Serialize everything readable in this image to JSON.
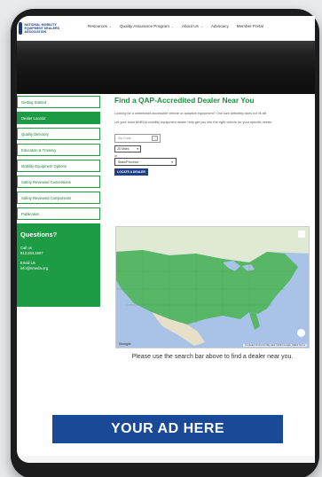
{
  "header": {
    "logo_text": "NATIONAL MOBILITY EQUIPMENT DEALERS ASSOCIATION",
    "menu": [
      {
        "label": "Resources",
        "has_dropdown": true
      },
      {
        "label": "Quality Assurance Program",
        "has_dropdown": true
      },
      {
        "label": "About Us",
        "has_dropdown": true
      },
      {
        "label": "Advocacy",
        "has_dropdown": false
      },
      {
        "label": "Member Portal",
        "has_dropdown": false
      }
    ]
  },
  "sidebar": {
    "items": [
      {
        "label": "Getting Started",
        "active": false
      },
      {
        "label": "Dealer Locator",
        "active": true
      },
      {
        "label": "Quality Directory",
        "active": false
      },
      {
        "label": "Education & Training",
        "active": false
      },
      {
        "label": "Mobility Equipment Options",
        "active": false
      },
      {
        "label": "Safety Reviewed Conversions",
        "active": false
      },
      {
        "label": "Safety Reviewed Components",
        "active": false
      },
      {
        "label": "Publication",
        "active": false
      }
    ],
    "questions": {
      "title": "Questions?",
      "call_label": "Call us",
      "phone": "813.264.2697",
      "email_label": "Email Us",
      "email": "info@nmeda.org"
    }
  },
  "main": {
    "title": "Find a QAP-Accredited Dealer Near You",
    "intro": "Looking for a wheelchair-accessible vehicle or adaptive equipment? One size definitely does not fit all!",
    "body": "Let your local NMEDA mobility equipment dealer help get you into the right vehicle for your specific needs.",
    "form": {
      "zip_placeholder": "Zip Code",
      "miles_value": "25 Miles",
      "or_label": "or",
      "state_value": "State/Province",
      "button_label": "LOCATE A DEALER"
    },
    "map": {
      "attribution": "Keyboard shortcuts  Map data ©2023 Google, INEGI  Terms",
      "google_label": "Google"
    },
    "hint": "Please use the search bar above to find a dealer near you."
  },
  "ad": {
    "label": "YOUR AD HERE"
  },
  "colors": {
    "brand_green": "#1e9b45",
    "brand_blue": "#1a4a97",
    "map_water": "#a9c3e8",
    "map_land_us": "#58b766"
  }
}
